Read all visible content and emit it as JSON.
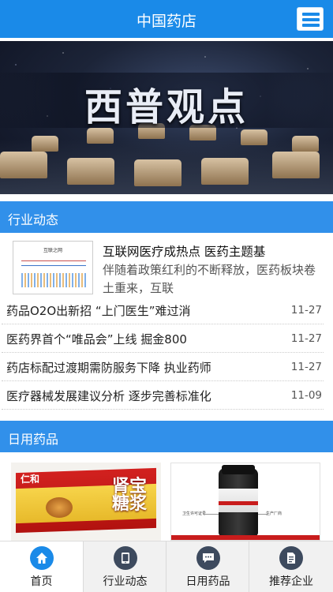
{
  "header": {
    "title": "中国药店",
    "menu_icon": "hamburger-menu-icon"
  },
  "banner": {
    "text": "西普观点"
  },
  "sections": {
    "industry": {
      "label": "行业动态"
    },
    "daily": {
      "label": "日用药品"
    }
  },
  "featured": {
    "title": "互联网医疗成热点 医药主题基",
    "description": "伴随着政策红利的不断释放，医药板块卷土重来，互联",
    "thumb_title": "互联之网"
  },
  "news": [
    {
      "title": "药品O2O出新招 “上门医生”难过消",
      "date": "11-27"
    },
    {
      "title": "医药界首个“唯品会”上线 掘金800",
      "date": "11-27"
    },
    {
      "title": "药店标配过渡期需防服务下降 执业药师",
      "date": "11-27"
    },
    {
      "title": "医疗器械发展建议分析 逐步完善标准化",
      "date": "11-09"
    }
  ],
  "products": [
    {
      "brand": "仁和",
      "name": "肾宝糖浆"
    },
    {
      "callouts": [
        "卫生许可证号",
        "生产厂商"
      ]
    }
  ],
  "bottom_nav": [
    {
      "label": "首页",
      "icon": "home-icon",
      "active": true
    },
    {
      "label": "行业动态",
      "icon": "tablet-icon",
      "active": false
    },
    {
      "label": "日用药品",
      "icon": "chat-bubble-icon",
      "active": false
    },
    {
      "label": "推荐企业",
      "icon": "document-icon",
      "active": false
    }
  ],
  "colors": {
    "primary": "#1a8ae8",
    "section_bar": "#3190ea",
    "nav_icon": "#3d4a5e"
  }
}
